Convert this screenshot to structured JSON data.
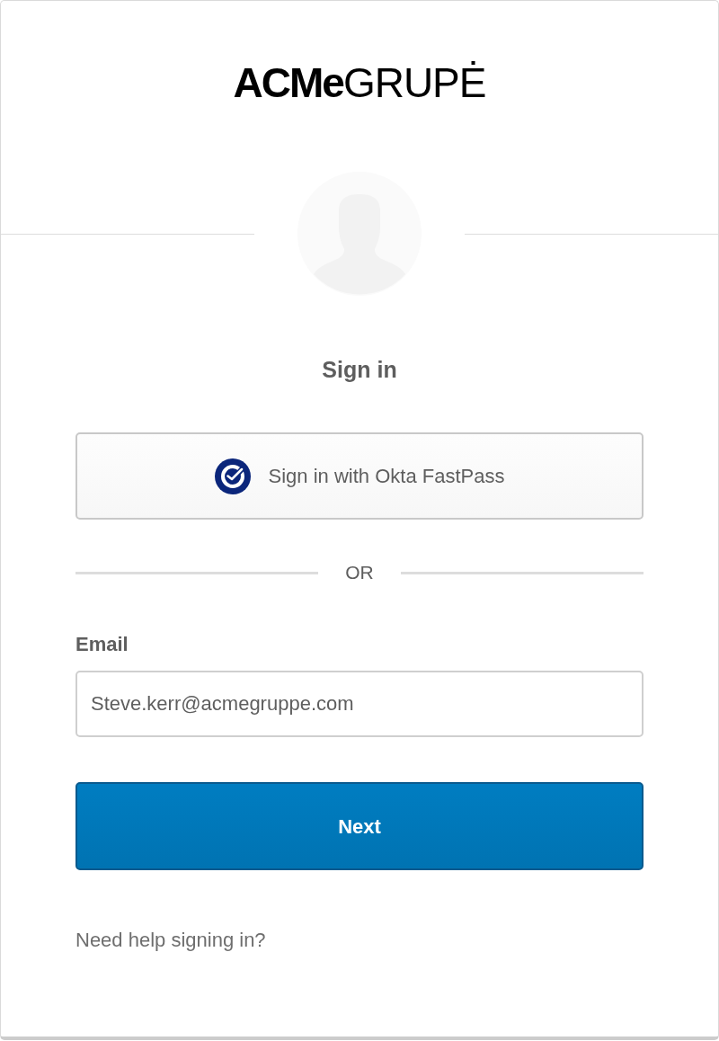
{
  "logo": {
    "wordmark": "**ACMe**GRUPĖ"
  },
  "title": "Sign in",
  "fastpass_button": {
    "label": "Sign in with Okta FastPass"
  },
  "divider": {
    "label": "OR"
  },
  "email": {
    "label": "Email",
    "value": "Steve.kerr@acmegruppe.com"
  },
  "submit_button": {
    "label": "Next"
  },
  "help_link": {
    "label": "Need help signing in?"
  }
}
